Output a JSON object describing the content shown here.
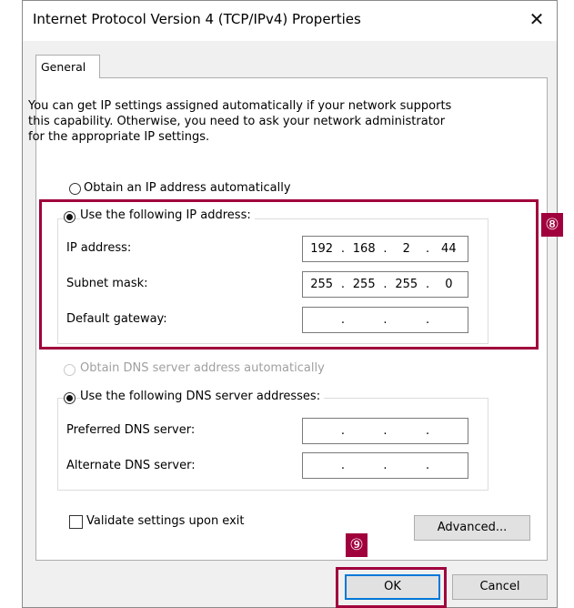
{
  "window": {
    "title": "Internet Protocol Version 4 (TCP/IPv4) Properties",
    "close_glyph": "✕"
  },
  "tabs": [
    {
      "label": "General"
    }
  ],
  "description": [
    "You can get IP settings assigned automatically if your network supports",
    "this capability. Otherwise, you need to ask your network administrator",
    "for the appropriate IP settings."
  ],
  "ip": {
    "auto_label": "Obtain an IP address automatically",
    "manual_label": "Use the following IP address:",
    "fields": [
      {
        "label": "IP address:",
        "octets": [
          "192",
          "168",
          "2",
          "44"
        ]
      },
      {
        "label": "Subnet mask:",
        "octets": [
          "255",
          "255",
          "255",
          "0"
        ]
      },
      {
        "label": "Default gateway:",
        "octets": [
          "",
          "",
          "",
          ""
        ]
      }
    ]
  },
  "dns": {
    "auto_label": "Obtain DNS server address automatically",
    "manual_label": "Use the following DNS server addresses:",
    "fields": [
      {
        "label": "Preferred DNS server:",
        "octets": [
          "",
          "",
          "",
          ""
        ]
      },
      {
        "label": "Alternate DNS server:",
        "octets": [
          "",
          "",
          "",
          ""
        ]
      }
    ]
  },
  "validate_label": "Validate settings upon exit",
  "buttons": {
    "advanced": "Advanced...",
    "ok": "OK",
    "cancel": "Cancel"
  },
  "annotations": {
    "step8": "⑧",
    "step9": "⑨",
    "color": "#a0003c"
  }
}
